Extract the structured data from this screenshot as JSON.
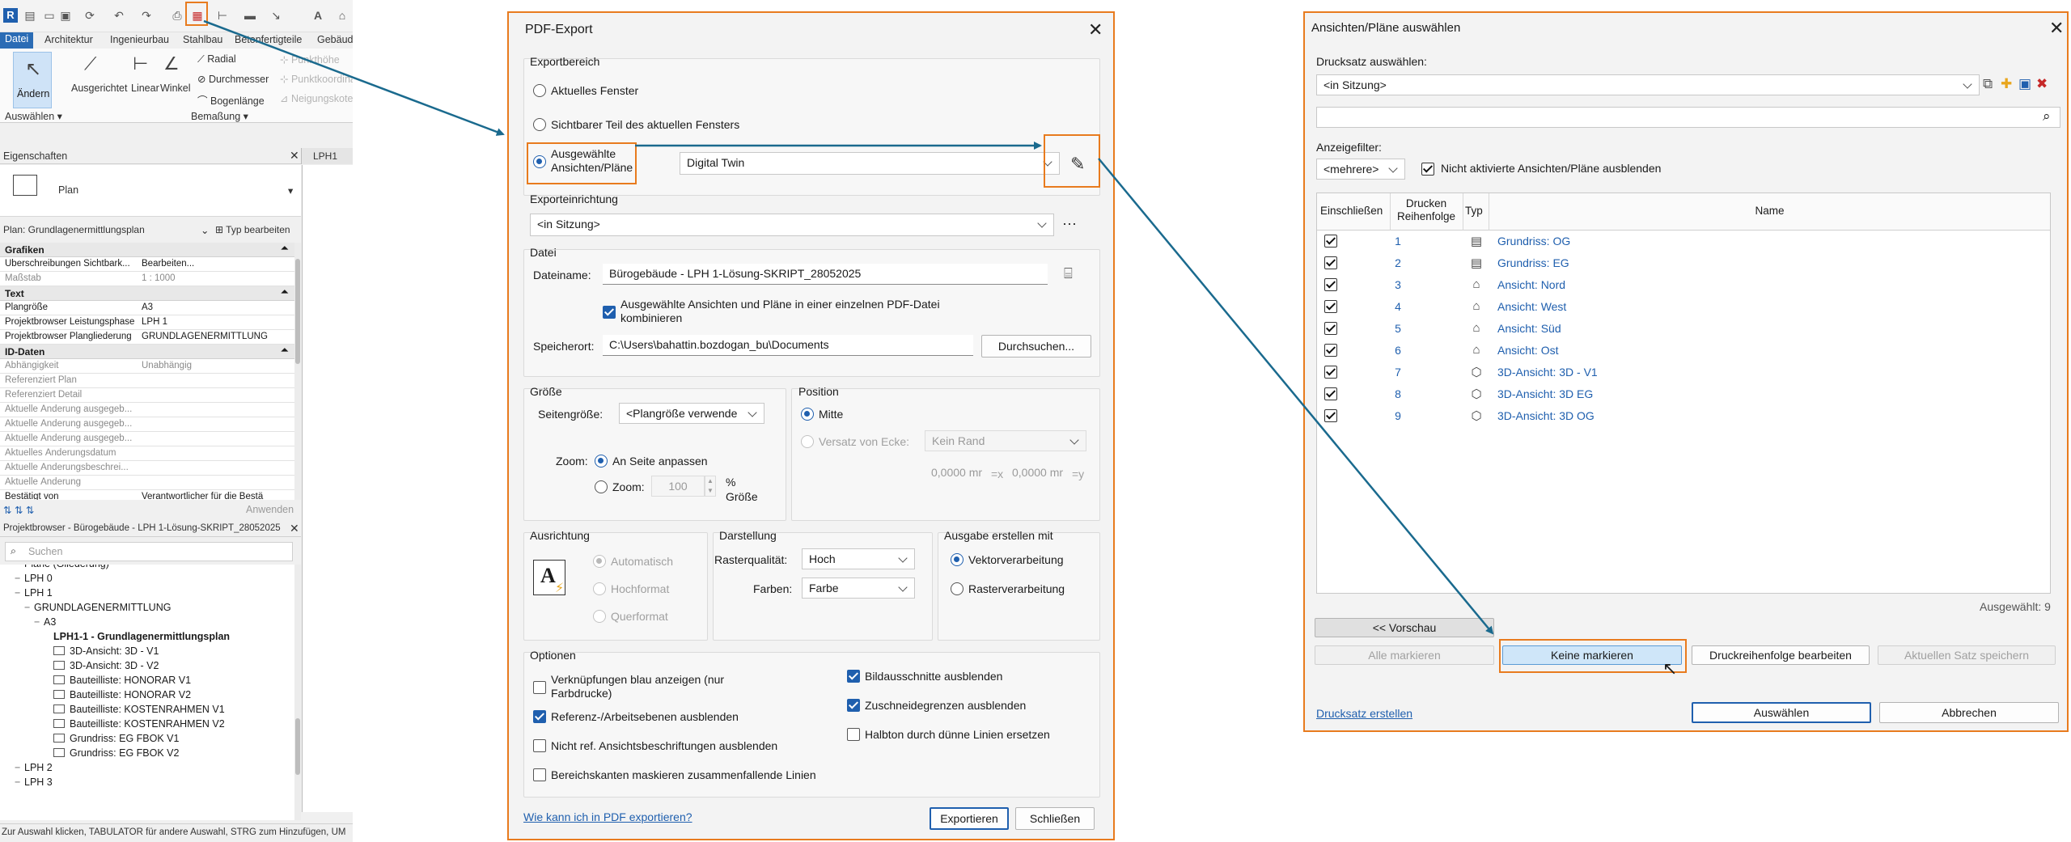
{
  "revit": {
    "app_badge": "R",
    "tabs": [
      "Datei",
      "Architektur",
      "Ingenieurbau",
      "Stahlbau",
      "Betonfertigteile",
      "Gebäud"
    ],
    "ribbon": {
      "modify_label": "Ändern",
      "aligned": "Ausgerichtet",
      "linear": "Linear",
      "angle": "Winkel",
      "radial": "Radial",
      "diameter": "Durchmesser",
      "arc_length": "Bogenlänge",
      "point_elev": "Punkthöhe",
      "point_coord": "Punktkoordinate",
      "slope": "Neigungskote",
      "select_group": "Auswählen",
      "dimension_group": "Bemaßung",
      "view_tab": "LPH1"
    },
    "properties": {
      "title": "Eigenschaften",
      "type_name": "Plan",
      "instance": "Plan: Grundlagenermittlungsplan",
      "edit_type": "Typ bearbeiten",
      "groups": [
        {
          "name": "Grafiken",
          "rows": [
            {
              "k": "Überschreibungen Sichtbark...",
              "v": "Bearbeiten...",
              "grey": false
            },
            {
              "k": "Maßstab",
              "v": "1 : 1000",
              "grey": true
            }
          ]
        },
        {
          "name": "Text",
          "rows": [
            {
              "k": "Plangröße",
              "v": "A3",
              "grey": false
            },
            {
              "k": "Projektbrowser Leistungsphase",
              "v": "LPH 1",
              "grey": false
            },
            {
              "k": "Projektbrowser Plangliederung",
              "v": "GRUNDLAGENERMITTLUNG",
              "grey": false
            }
          ]
        },
        {
          "name": "ID-Daten",
          "rows": [
            {
              "k": "Abhängigkeit",
              "v": "Unabhängig",
              "grey": true
            },
            {
              "k": "Referenziert Plan",
              "v": "",
              "grey": true
            },
            {
              "k": "Referenziert Detail",
              "v": "",
              "grey": true
            },
            {
              "k": "Aktuelle Änderung ausgegeb...",
              "v": "",
              "grey": true
            },
            {
              "k": "Aktuelle Änderung ausgegeb...",
              "v": "",
              "grey": true
            },
            {
              "k": "Aktuelle Änderung ausgegeb...",
              "v": "",
              "grey": true
            },
            {
              "k": "Aktuelles Änderungsdatum",
              "v": "",
              "grey": true
            },
            {
              "k": "Aktuelle Änderungsbeschrei...",
              "v": "",
              "grey": true
            },
            {
              "k": "Aktuelle Änderung",
              "v": "",
              "grey": true
            },
            {
              "k": "Bestätigt von",
              "v": "Verantwortlicher für die Bestä",
              "grey": false
            }
          ]
        }
      ],
      "apply": "Anwenden"
    },
    "browser": {
      "title": "Projektbrowser - Bürogebäude - LPH 1-Lösung-SKRIPT_28052025",
      "search_placeholder": "Suchen",
      "items": [
        {
          "label": "Pläne (Gliederung)",
          "indent": 1,
          "bold": false,
          "icon": false
        },
        {
          "label": "LPH 0",
          "indent": 1,
          "bold": false,
          "icon": false
        },
        {
          "label": "LPH 1",
          "indent": 1,
          "bold": false,
          "icon": false
        },
        {
          "label": "GRUNDLAGENERMITTLUNG",
          "indent": 2,
          "bold": false,
          "icon": false
        },
        {
          "label": "A3",
          "indent": 3,
          "bold": false,
          "icon": false
        },
        {
          "label": "LPH1-1 - Grundlagenermittlungsplan",
          "indent": 4,
          "bold": true,
          "icon": false
        },
        {
          "label": "3D-Ansicht: 3D - V1",
          "indent": 5,
          "bold": false,
          "icon": true
        },
        {
          "label": "3D-Ansicht: 3D - V2",
          "indent": 5,
          "bold": false,
          "icon": true
        },
        {
          "label": "Bauteilliste: HONORAR V1",
          "indent": 5,
          "bold": false,
          "icon": true
        },
        {
          "label": "Bauteilliste: HONORAR V2",
          "indent": 5,
          "bold": false,
          "icon": true
        },
        {
          "label": "Bauteilliste: KOSTENRAHMEN V1",
          "indent": 5,
          "bold": false,
          "icon": true
        },
        {
          "label": "Bauteilliste: KOSTENRAHMEN V2",
          "indent": 5,
          "bold": false,
          "icon": true
        },
        {
          "label": "Grundriss: EG FBOK V1",
          "indent": 5,
          "bold": false,
          "icon": true
        },
        {
          "label": "Grundriss: EG FBOK V2",
          "indent": 5,
          "bold": false,
          "icon": true
        },
        {
          "label": "LPH 2",
          "indent": 1,
          "bold": false,
          "icon": false
        },
        {
          "label": "LPH 3",
          "indent": 1,
          "bold": false,
          "icon": false
        }
      ]
    },
    "status_bar": "Zur Auswahl klicken, TABULATOR für andere Auswahl, STRG zum Hinzufügen, UM"
  },
  "pdf": {
    "title": "PDF-Export",
    "export_range": {
      "label": "Exportbereich",
      "opt_current": "Aktuelles Fenster",
      "opt_visible": "Sichtbarer Teil des aktuellen Fensters",
      "opt_selected": "Ausgewählte Ansichten/Pläne",
      "selected_set": "Digital Twin"
    },
    "setup": {
      "label": "Exporteinrichtung",
      "value": "<in Sitzung>",
      "more": "···"
    },
    "file": {
      "label": "Datei",
      "name_label": "Dateiname:",
      "name_value": "Bürogebäude - LPH 1-Lösung-SKRIPT_28052025",
      "combine": "Ausgewählte Ansichten und Pläne in einer einzelnen PDF-Datei kombinieren",
      "location_label": "Speicherort:",
      "location_value": "C:\\Users\\bahattin.bozdogan_bu\\Documents",
      "browse": "Durchsuchen..."
    },
    "size": {
      "label": "Größe",
      "page_label": "Seitengröße:",
      "page_value": "<Plangröße verwende",
      "zoom_label": "Zoom:",
      "fit": "An Seite anpassen",
      "zoom_opt": "Zoom:",
      "zoom_value": "100",
      "percent": "%",
      "size_word": "Größe"
    },
    "position": {
      "label": "Position",
      "center": "Mitte",
      "offset": "Versatz von Ecke:",
      "margin": "Kein Rand",
      "x_value": "0,0000 mr",
      "x_label": "=x",
      "y_value": "0,0000 mr",
      "y_label": "=y"
    },
    "orientation": {
      "label": "Ausrichtung",
      "auto": "Automatisch",
      "portrait": "Hochformat",
      "landscape": "Querformat"
    },
    "display": {
      "label": "Darstellung",
      "raster_label": "Rasterqualität:",
      "raster_value": "Hoch",
      "colors_label": "Farben:",
      "colors_value": "Farbe"
    },
    "output": {
      "label": "Ausgabe erstellen mit",
      "vector": "Vektorverarbeitung",
      "raster": "Rasterverarbeitung"
    },
    "options": {
      "label": "Optionen",
      "links_blue": "Verknüpfungen blau anzeigen (nur Farbdrucke)",
      "hide_ref": "Referenz-/Arbeitsebenen ausblenden",
      "hide_unref": "Nicht ref. Ansichtsbeschriftungen ausblenden",
      "mask": "Bereichskanten maskieren zusammenfallende Linien",
      "hide_scope": "Bildausschnitte ausblenden",
      "hide_crop": "Zuschneidegrenzen ausblenden",
      "halftone": "Halbton durch dünne Linien ersetzen"
    },
    "help_link": "Wie kann ich in PDF exportieren?",
    "export_btn": "Exportieren",
    "close_btn": "Schließen"
  },
  "views": {
    "title": "Ansichten/Pläne auswählen",
    "set_label": "Drucksatz auswählen:",
    "set_value": "<in Sitzung>",
    "filter_label": "Anzeigefilter:",
    "filter_value": "<mehrere>",
    "hide_inactive": "Nicht aktivierte Ansichten/Pläne ausblenden",
    "columns": {
      "include": "Einschließen",
      "order": "Drucken Reihenfolge",
      "type": "Typ",
      "name": "Name"
    },
    "rows": [
      {
        "n": "1",
        "name": "Grundriss: OG",
        "type": "plan"
      },
      {
        "n": "2",
        "name": "Grundriss: EG",
        "type": "plan"
      },
      {
        "n": "3",
        "name": "Ansicht: Nord",
        "type": "elev"
      },
      {
        "n": "4",
        "name": "Ansicht: West",
        "type": "elev"
      },
      {
        "n": "5",
        "name": "Ansicht: Süd",
        "type": "elev"
      },
      {
        "n": "6",
        "name": "Ansicht: Ost",
        "type": "elev"
      },
      {
        "n": "7",
        "name": "3D-Ansicht: 3D - V1",
        "type": "3d"
      },
      {
        "n": "8",
        "name": "3D-Ansicht: 3D EG",
        "type": "3d"
      },
      {
        "n": "9",
        "name": "3D-Ansicht: 3D OG",
        "type": "3d"
      }
    ],
    "selected_count": "Ausgewählt: 9",
    "preview_btn": "<< Vorschau",
    "select_all": "Alle markieren",
    "select_none": "Keine markieren",
    "edit_order": "Druckreihenfolge bearbeiten",
    "save_set": "Aktuellen Satz speichern",
    "create_set": "Drucksatz erstellen",
    "ok_btn": "Auswählen",
    "cancel_btn": "Abbrechen"
  },
  "colors": {
    "highlight": "#e87b1e",
    "arrow": "#1a6a8e",
    "accent": "#1f5fae"
  }
}
